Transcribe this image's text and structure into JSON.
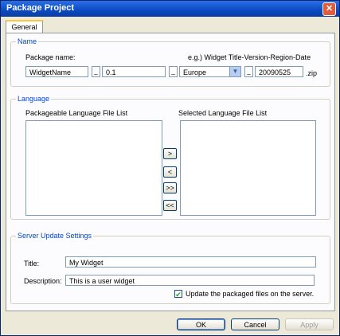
{
  "window": {
    "title": "Package Project"
  },
  "tabs": [
    {
      "label": "General"
    }
  ],
  "name_group": {
    "title": "Name",
    "package_name_label": "Package name:",
    "example_label": "e.g.) Widget Title-Version-Region-Date",
    "widget_name_value": "WidgetName",
    "separator": "_",
    "version_value": "0.1",
    "region_value": "Europe",
    "date_value": "20090525",
    "extension": ".zip"
  },
  "language_group": {
    "title": "Language",
    "packageable_label": "Packageable Language File List",
    "selected_label": "Selected Language File List",
    "move_buttons": [
      ">",
      "<",
      ">>",
      "<<"
    ]
  },
  "server_group": {
    "title": "Server Update Settings",
    "title_label": "Title:",
    "title_value": "My Widget",
    "description_label": "Description:",
    "description_value": "This is a user widget",
    "checkbox_label": "Update the packaged files on the server.",
    "checkbox_checked": true
  },
  "buttons": {
    "ok": "OK",
    "cancel": "Cancel",
    "apply": "Apply"
  },
  "icons": {
    "close": "close-icon",
    "dropdown": "chevron-down-icon",
    "check": "checkmark-icon"
  }
}
